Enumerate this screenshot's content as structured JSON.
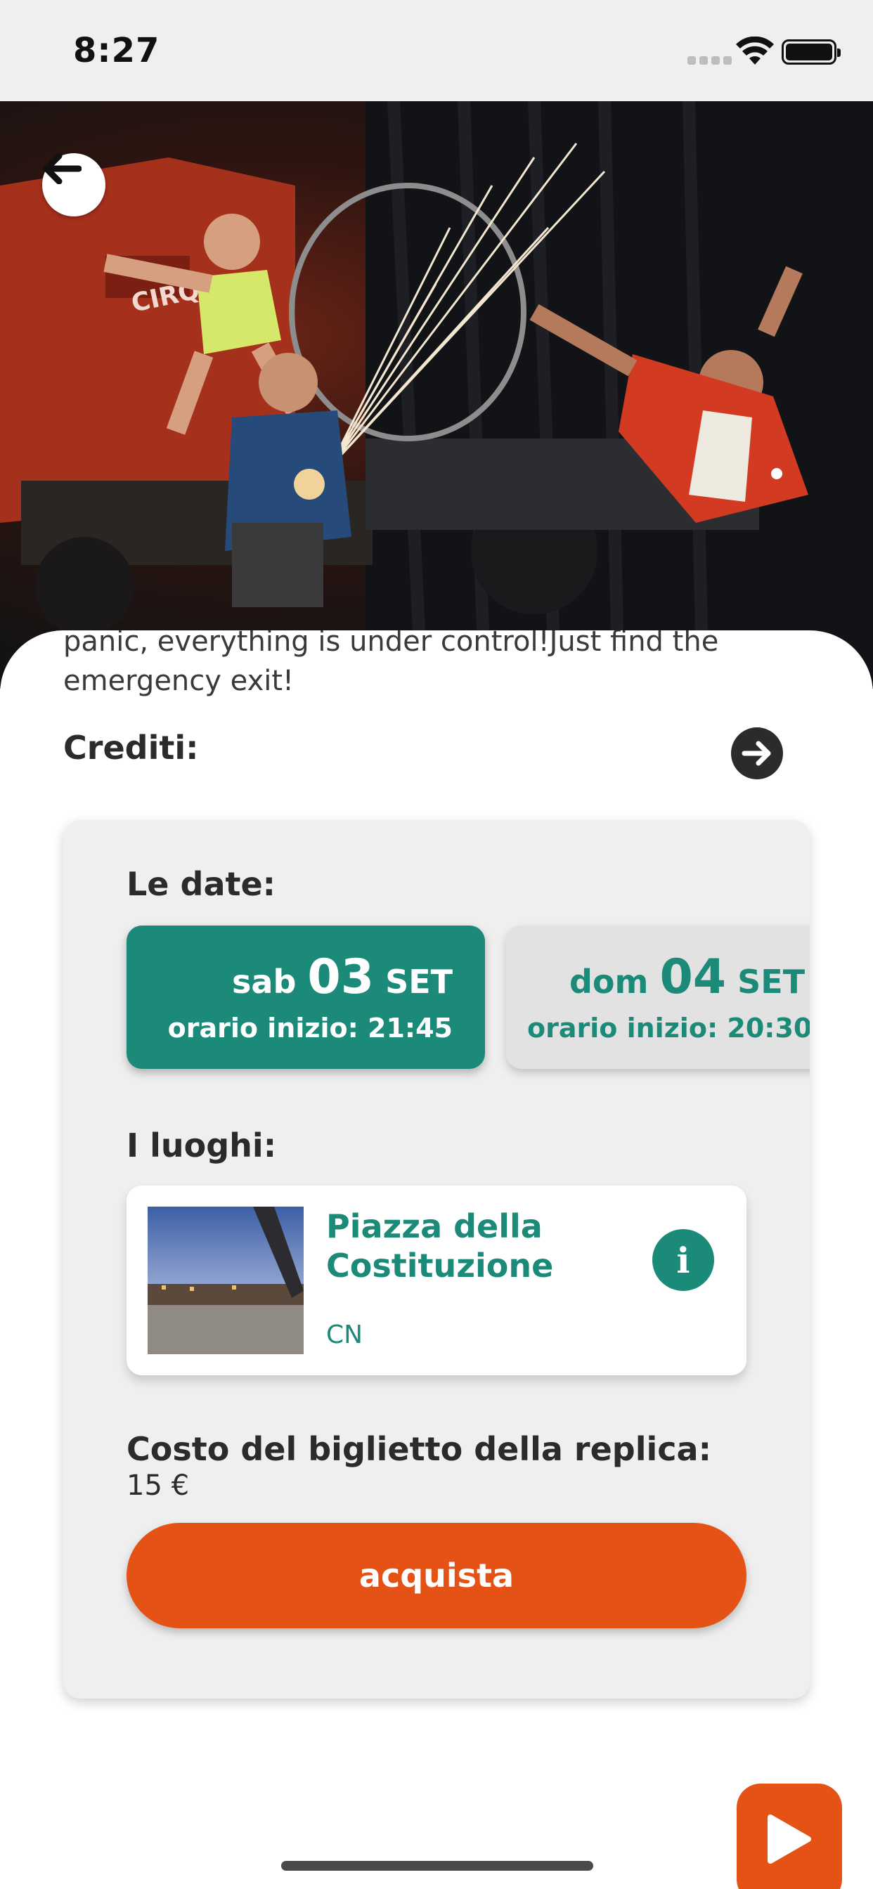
{
  "status_bar": {
    "time": "8:27"
  },
  "hero": {
    "image": "circus-performers-photo"
  },
  "description_tail": "panic, everything is under control!Just find the emergency exit!",
  "credits": {
    "label": "Crediti:"
  },
  "dates": {
    "label": "Le date:",
    "items": [
      {
        "weekday": "sab",
        "day": "03",
        "month": "SET",
        "time_label": "orario inizio:",
        "time": "21:45",
        "selected": true
      },
      {
        "weekday": "dom",
        "day": "04",
        "month": "SET",
        "time_label": "orario inizio:",
        "time": "20:30",
        "selected": false
      }
    ]
  },
  "places": {
    "label": "I luoghi:",
    "items": [
      {
        "name": "Piazza della Costituzione",
        "province": "CN"
      }
    ]
  },
  "ticket": {
    "label": "Costo del biglietto della replica:",
    "price": "15 €",
    "buy_label": "acquista"
  },
  "colors": {
    "accent_teal": "#1b8a78",
    "accent_orange": "#e55215"
  },
  "icons": [
    "back-arrow-icon",
    "arrow-right-icon",
    "info-icon",
    "play-icon",
    "wifi-icon",
    "battery-icon"
  ]
}
